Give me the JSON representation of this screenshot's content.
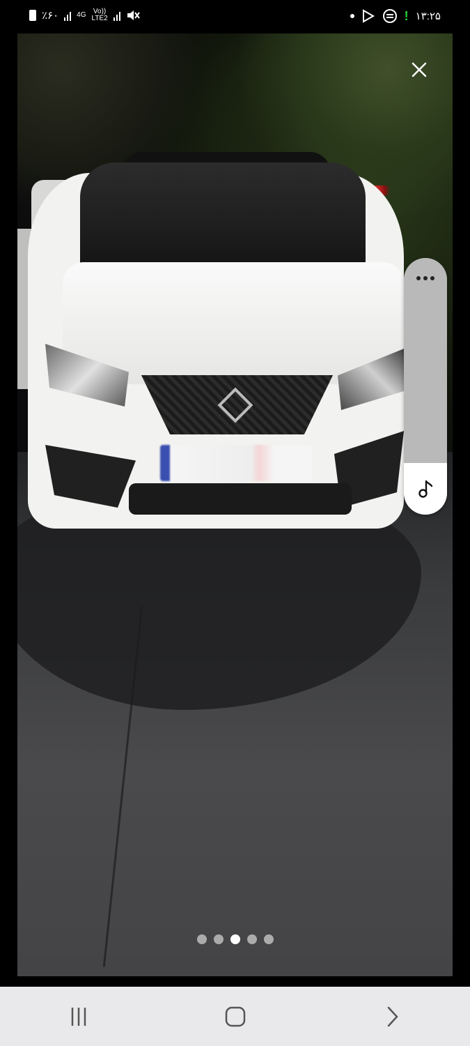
{
  "status_bar": {
    "battery_text": "٪۶۰",
    "network_top": "4G",
    "network_volte": "Vo))",
    "network_lte": "LTE2",
    "time": "۱۳:۲۵"
  },
  "viewer": {
    "current_page": 3,
    "total_pages": 5
  },
  "colors": {
    "status_excl": "#27d13c",
    "nav_bar": "#e9e9eb"
  },
  "icons": {
    "close": "close-icon",
    "more": "more-horizontal-icon",
    "music": "music-note-icon",
    "recents": "recents-icon",
    "home": "home-icon",
    "back": "back-icon"
  }
}
